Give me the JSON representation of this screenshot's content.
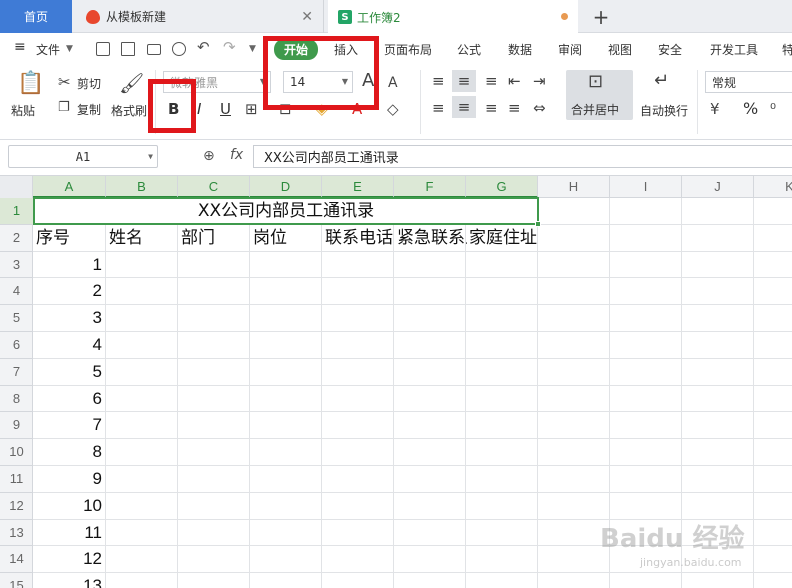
{
  "tabs": {
    "home": "首页",
    "template": "从模板新建",
    "workbook": "工作簿2",
    "workbook_badge": "S"
  },
  "menu": {
    "file": "文件",
    "items": [
      "开始",
      "插入",
      "页面布局",
      "公式",
      "数据",
      "审阅",
      "视图",
      "安全",
      "开发工具",
      "特"
    ]
  },
  "ribbon": {
    "paste": "粘贴",
    "cut": "剪切",
    "copy": "复制",
    "format_painter": "格式刷",
    "font_name": "微软雅黑",
    "font_size": "14",
    "bold": "B",
    "italic": "I",
    "underline": "U",
    "merge_center": "合并居中",
    "auto_wrap": "自动换行",
    "number_format": "常规",
    "percent": "%"
  },
  "formula_bar": {
    "name_box": "A1",
    "fx": "fx",
    "content": "XX公司内部员工通讯录"
  },
  "sheet": {
    "columns": [
      "A",
      "B",
      "C",
      "D",
      "E",
      "F",
      "G",
      "H",
      "I",
      "J",
      "K"
    ],
    "rows": [
      "1",
      "2",
      "3",
      "4",
      "5",
      "6",
      "7",
      "8",
      "9",
      "10",
      "11",
      "12",
      "13",
      "14",
      "15"
    ],
    "title": "XX公司内部员工通讯录",
    "headers": [
      "序号",
      "姓名",
      "部门",
      "岗位",
      "联系电话",
      "紧急联系人",
      "家庭住址"
    ],
    "numbers": [
      "1",
      "2",
      "3",
      "4",
      "5",
      "6",
      "7",
      "8",
      "9",
      "10",
      "11",
      "12",
      "13"
    ]
  },
  "watermark": {
    "main": "Baidu 经验",
    "sub": "jingyan.baidu.com"
  },
  "colors": {
    "accent_green": "#3f9a4c",
    "tab_blue": "#3f7bd6",
    "highlight_red": "#e0171b"
  }
}
